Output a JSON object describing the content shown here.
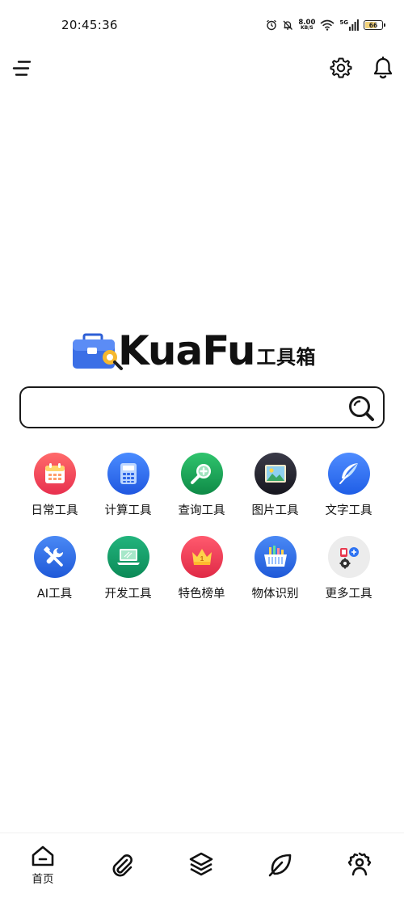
{
  "status_bar": {
    "time": "20:45:36",
    "net_speed_value": "8.00",
    "net_speed_unit": "KB/S",
    "network": "5G",
    "battery": "66",
    "battery_level": 0.66,
    "icons": [
      "alarm-icon",
      "mute-icon",
      "wifi-icon",
      "signal-icon",
      "battery-icon"
    ]
  },
  "top_bar": {
    "icons": [
      "menu-icon",
      "settings-icon",
      "bell-icon"
    ]
  },
  "logo": {
    "word": "KuaFu",
    "sub": "工具箱"
  },
  "search": {
    "value": "",
    "placeholder": ""
  },
  "tools": [
    {
      "label": "日常工具",
      "icon": "calendar-icon",
      "color": "#ee3d54"
    },
    {
      "label": "计算工具",
      "icon": "calculator-icon",
      "color": "#2f6cf0"
    },
    {
      "label": "查询工具",
      "icon": "magnifier-icon",
      "color": "#1ba157"
    },
    {
      "label": "图片工具",
      "icon": "picture-icon",
      "color": "#262632"
    },
    {
      "label": "文字工具",
      "icon": "feather-icon",
      "color": "#2e73f2"
    },
    {
      "label": "AI工具",
      "icon": "wrench-icon",
      "color": "#2d6fe8"
    },
    {
      "label": "开发工具",
      "icon": "laptop-icon",
      "color": "#13a06a"
    },
    {
      "label": "特色榜单",
      "icon": "crown-icon",
      "color": "#ef3b55"
    },
    {
      "label": "物体识别",
      "icon": "basket-icon",
      "color": "#2d6fe8"
    },
    {
      "label": "更多工具",
      "icon": "more-apps-icon",
      "color": "#eeeeee"
    }
  ],
  "bottom_nav": {
    "home_label": "首页",
    "items": [
      "home-icon",
      "paperclip-icon",
      "layers-icon",
      "leaf-icon",
      "gear-person-icon"
    ]
  }
}
